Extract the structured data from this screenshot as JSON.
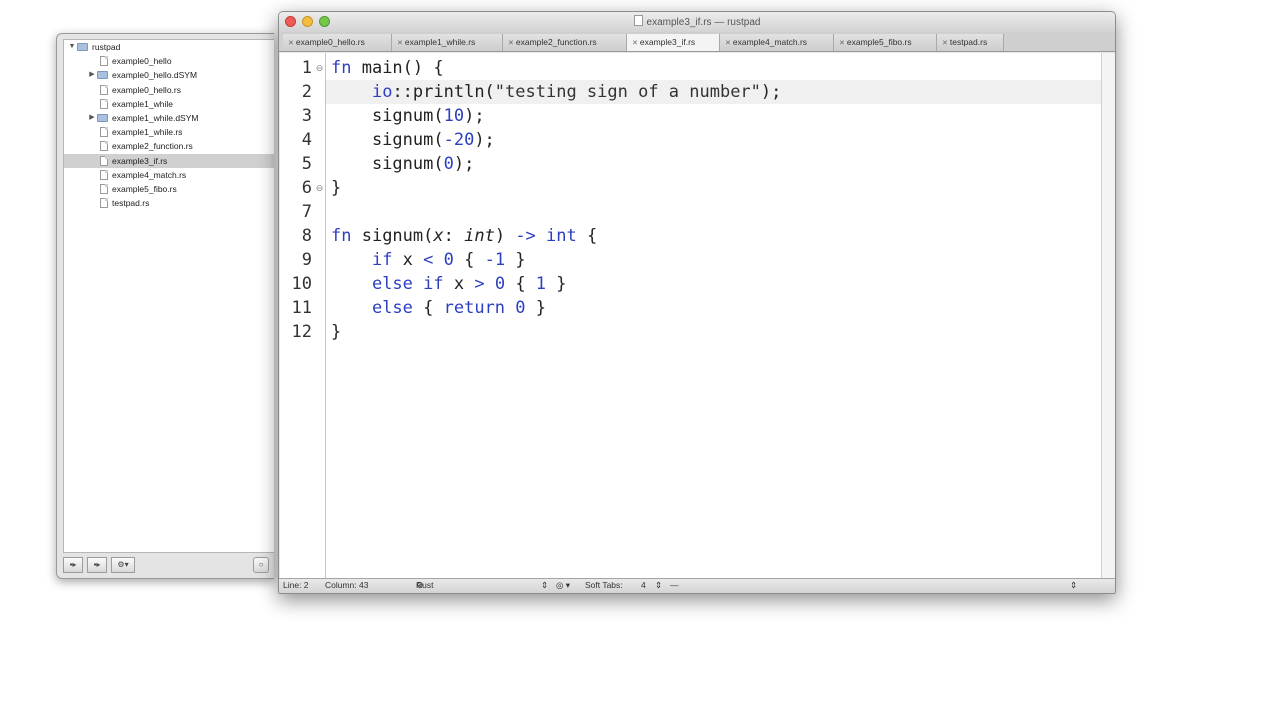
{
  "window": {
    "title": "example3_if.rs — rustpad"
  },
  "project": {
    "items": [
      {
        "label": "rustpad",
        "type": "folder",
        "level": 0,
        "disclosure": "▼"
      },
      {
        "label": "example0_hello",
        "type": "file",
        "level": 1
      },
      {
        "label": "example0_hello.dSYM",
        "type": "folder",
        "level": 1,
        "disclosure": "▶"
      },
      {
        "label": "example0_hello.rs",
        "type": "file",
        "level": 1
      },
      {
        "label": "example1_while",
        "type": "file",
        "level": 1
      },
      {
        "label": "example1_while.dSYM",
        "type": "folder",
        "level": 1,
        "disclosure": "▶"
      },
      {
        "label": "example1_while.rs",
        "type": "file",
        "level": 1
      },
      {
        "label": "example2_function.rs",
        "type": "file",
        "level": 1
      },
      {
        "label": "example3_if.rs",
        "type": "file",
        "level": 1,
        "selected": true
      },
      {
        "label": "example4_match.rs",
        "type": "file",
        "level": 1
      },
      {
        "label": "example5_fibo.rs",
        "type": "file",
        "level": 1
      },
      {
        "label": "testpad.rs",
        "type": "file",
        "level": 1
      }
    ],
    "toolbar": {
      "add_file": "▸",
      "add_folder": "▸",
      "gear": "⚙▾"
    }
  },
  "tabs": [
    {
      "label": "example0_hello.rs"
    },
    {
      "label": "example1_while.rs"
    },
    {
      "label": "example2_function.rs"
    },
    {
      "label": "example3_if.rs",
      "active": true
    },
    {
      "label": "example4_match.rs"
    },
    {
      "label": "example5_fibo.rs"
    },
    {
      "label": "testpad.rs"
    }
  ],
  "editor": {
    "line_numbers": [
      "1",
      "2",
      "3",
      "4",
      "5",
      "6",
      "7",
      "8",
      "9",
      "10",
      "11",
      "12"
    ],
    "current_line": 2
  },
  "status": {
    "line": "Line: 2",
    "column": "Column: 43",
    "language": "Rust",
    "soft_tabs": "Soft Tabs:",
    "tab_size": "4",
    "dash": "—"
  },
  "colors": {
    "keyword": "#2b3fbf",
    "current_line": "#f0f0f0"
  }
}
